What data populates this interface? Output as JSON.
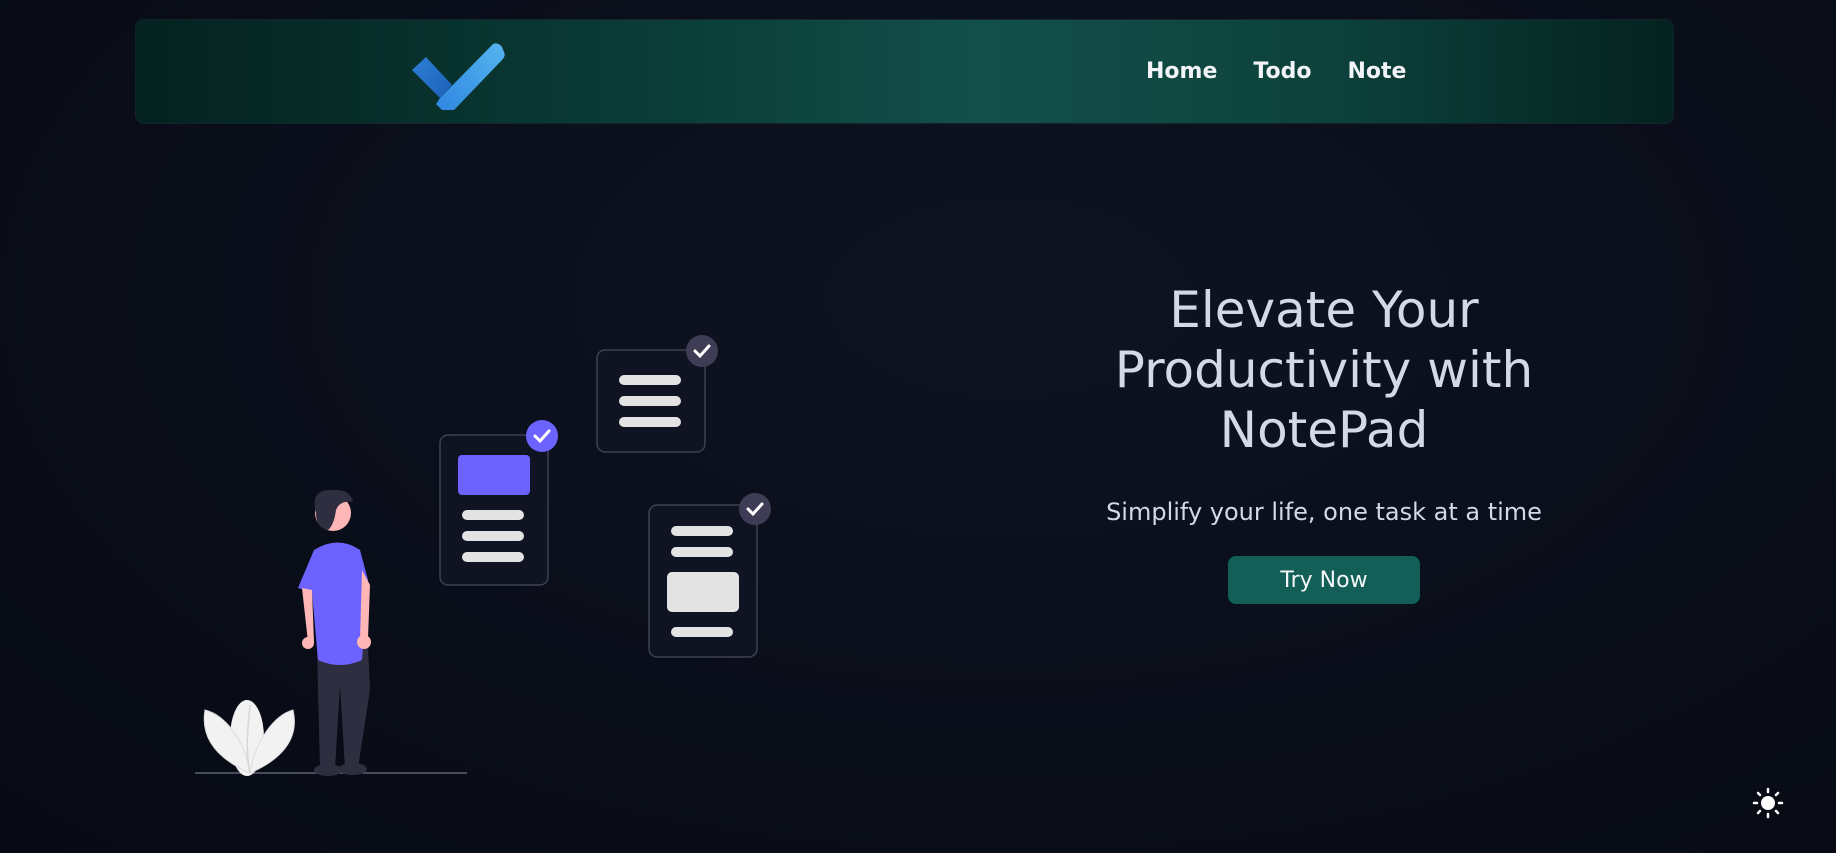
{
  "nav": {
    "logo": "checkmark-logo-icon",
    "links": [
      {
        "label": "Home"
      },
      {
        "label": "Todo"
      },
      {
        "label": "Note"
      }
    ]
  },
  "hero": {
    "title": "Elevate Your Productivity with NotePad",
    "subtitle": "Simplify your life, one task at a time",
    "cta_label": "Try Now"
  },
  "theme_toggle": {
    "icon": "sun-icon"
  },
  "colors": {
    "background": "#0b0f1b",
    "navbar_accent": "#134f4a",
    "button": "#135e57",
    "illustration_accent": "#6c63ff",
    "logo_blue": "#3a8dde"
  }
}
